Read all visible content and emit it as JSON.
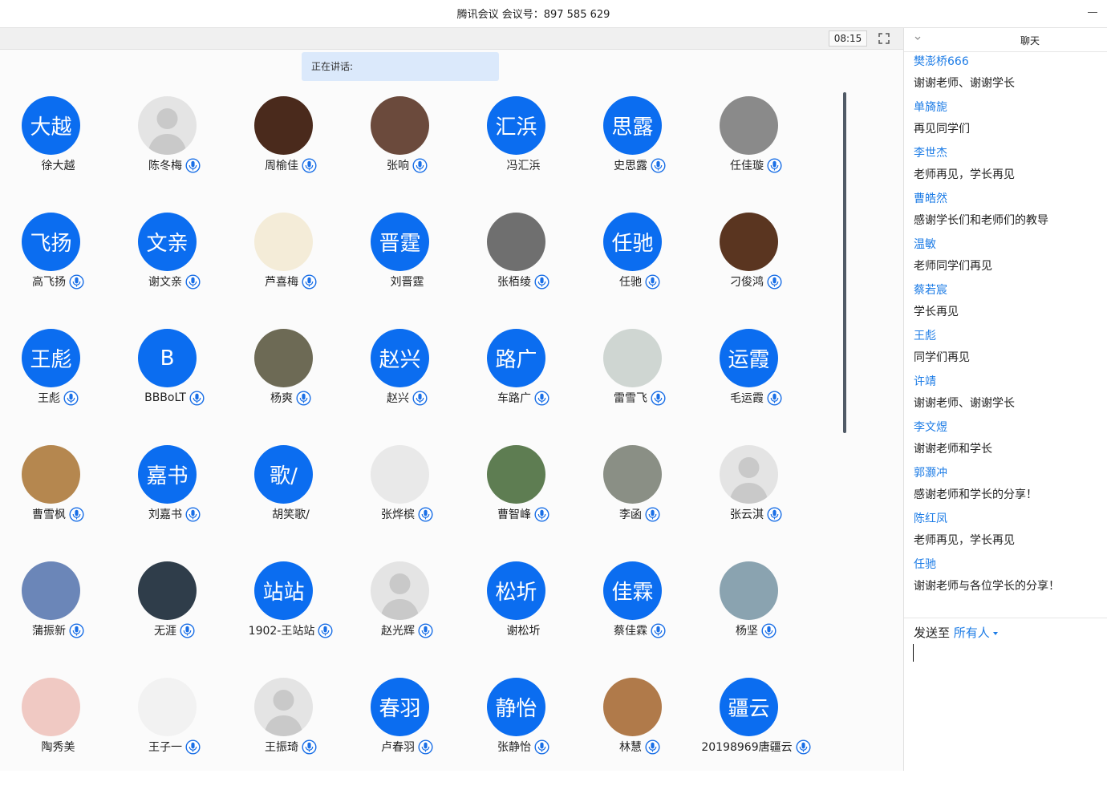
{
  "window": {
    "title": "腾讯会议 会议号：897 585 629"
  },
  "toolbar": {
    "timer": "08:15"
  },
  "speaking_label": "正在讲话:",
  "participants": [
    {
      "name": "徐大越",
      "avatar_text": "大越",
      "avatar": "blue",
      "mic": false
    },
    {
      "name": "陈冬梅",
      "avatar": "gray",
      "mic": true,
      "host": true
    },
    {
      "name": "周榆佳",
      "avatar": "photo",
      "color": "#4a2a1c",
      "mic": true
    },
    {
      "name": "张响",
      "avatar": "photo",
      "color": "#6b4a3c",
      "mic": true
    },
    {
      "name": "冯汇浜",
      "avatar_text": "汇浜",
      "avatar": "blue",
      "mic": false
    },
    {
      "name": "史思露",
      "avatar_text": "思露",
      "avatar": "blue",
      "mic": true
    },
    {
      "name": "任佳璇",
      "avatar": "photo",
      "color": "#8a8a8a",
      "mic": true
    },
    {
      "name": "高飞扬",
      "avatar_text": "飞扬",
      "avatar": "blue",
      "mic": true
    },
    {
      "name": "谢文亲",
      "avatar_text": "文亲",
      "avatar": "blue",
      "mic": true
    },
    {
      "name": "芦喜梅",
      "avatar": "photo",
      "color": "#f4ecd8",
      "mic": true
    },
    {
      "name": "刘晋霆",
      "avatar_text": "晋霆",
      "avatar": "blue",
      "mic": false
    },
    {
      "name": "张栢绫",
      "avatar": "photo",
      "color": "#6f6f6f",
      "mic": true
    },
    {
      "name": "任驰",
      "avatar_text": "任驰",
      "avatar": "blue",
      "mic": true
    },
    {
      "name": "刁俊鸿",
      "avatar": "photo",
      "color": "#5a3520",
      "mic": true
    },
    {
      "name": "王彪",
      "avatar_text": "王彪",
      "avatar": "blue",
      "mic": true
    },
    {
      "name": "BBBoLT",
      "avatar_text": "B",
      "avatar": "blue",
      "mic": true
    },
    {
      "name": "杨爽",
      "avatar": "photo",
      "color": "#6d6a55",
      "mic": true
    },
    {
      "name": "赵兴",
      "avatar_text": "赵兴",
      "avatar": "blue",
      "mic": true
    },
    {
      "name": "车路广",
      "avatar_text": "路广",
      "avatar": "blue",
      "mic": true
    },
    {
      "name": "雷雪飞",
      "avatar": "photo",
      "color": "#cfd6d2",
      "mic": true
    },
    {
      "name": "毛运霞",
      "avatar_text": "运霞",
      "avatar": "blue",
      "mic": true
    },
    {
      "name": "曹雪枫",
      "avatar": "photo",
      "color": "#b5874f",
      "mic": true
    },
    {
      "name": "刘嘉书",
      "avatar_text": "嘉书",
      "avatar": "blue",
      "mic": true
    },
    {
      "name": "胡笑歌/",
      "avatar_text": "歌/",
      "avatar": "blue",
      "mic": false
    },
    {
      "name": "张烨槟",
      "avatar": "photo",
      "color": "#e9e9e9",
      "mic": true
    },
    {
      "name": "曹智峰",
      "avatar": "photo",
      "color": "#5e7d52",
      "mic": true
    },
    {
      "name": "李函",
      "avatar": "photo",
      "color": "#8a8f85",
      "mic": true
    },
    {
      "name": "张云淇",
      "avatar": "gray",
      "mic": true
    },
    {
      "name": "蒲振新",
      "avatar": "photo",
      "color": "#6b86b8",
      "mic": true
    },
    {
      "name": "无涯",
      "avatar": "photo",
      "color": "#2f3d4a",
      "mic": true
    },
    {
      "name": "1902-王站站",
      "avatar_text": "站站",
      "avatar": "blue",
      "mic": true
    },
    {
      "name": "赵光辉",
      "avatar": "gray",
      "mic": true
    },
    {
      "name": "谢松圻",
      "avatar_text": "松圻",
      "avatar": "blue",
      "mic": false
    },
    {
      "name": "蔡佳霖",
      "avatar_text": "佳霖",
      "avatar": "blue",
      "mic": true
    },
    {
      "name": "杨坚",
      "avatar": "photo",
      "color": "#8aa3b0",
      "mic": true
    },
    {
      "name": "陶秀美",
      "avatar": "photo",
      "color": "#f0c9c3",
      "mic": false
    },
    {
      "name": "王子一",
      "avatar": "photo",
      "color": "#f2f2f2",
      "mic": true
    },
    {
      "name": "王振琦",
      "avatar": "gray",
      "mic": true
    },
    {
      "name": "卢春羽",
      "avatar_text": "春羽",
      "avatar": "blue",
      "mic": true
    },
    {
      "name": "张静怡",
      "avatar_text": "静怡",
      "avatar": "blue",
      "mic": true
    },
    {
      "name": "林慧",
      "avatar": "photo",
      "color": "#b07a4a",
      "mic": true
    },
    {
      "name": "20198969唐疆云",
      "avatar_text": "疆云",
      "avatar": "blue",
      "mic": true
    }
  ],
  "chat": {
    "title": "聊天",
    "messages": [
      {
        "sender": "樊澎桥666",
        "text": "谢谢老师、谢谢学长"
      },
      {
        "sender": "单旖旎",
        "text": "再见同学们"
      },
      {
        "sender": "李世杰",
        "text": "老师再见，学长再见"
      },
      {
        "sender": "曹皓然",
        "text": "感谢学长们和老师们的教导"
      },
      {
        "sender": "温敏",
        "text": "老师同学们再见"
      },
      {
        "sender": "蔡若宸",
        "text": "学长再见"
      },
      {
        "sender": "王彪",
        "text": "同学们再见"
      },
      {
        "sender": "许靖",
        "text": "谢谢老师、谢谢学长"
      },
      {
        "sender": "李文煜",
        "text": "谢谢老师和学长"
      },
      {
        "sender": "郭灏冲",
        "text": "感谢老师和学长的分享！"
      },
      {
        "sender": "陈红凤",
        "text": "老师再见，学长再见"
      },
      {
        "sender": "任驰",
        "text": "谢谢老师与各位学长的分享！"
      }
    ],
    "send_to_label": "发送至",
    "send_to_target": "所有人"
  },
  "colors": {
    "accent": "#0b6df0",
    "link": "#1d7ce6"
  }
}
